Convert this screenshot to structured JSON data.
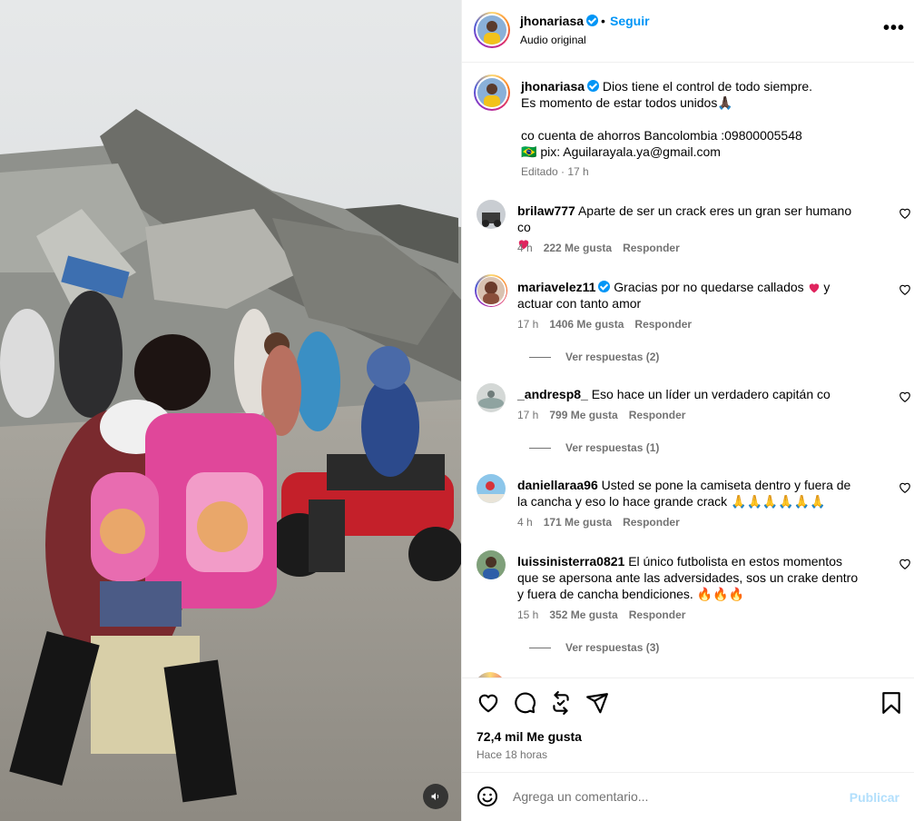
{
  "post": {
    "author": "jhonariasa",
    "follow_label": "Seguir",
    "separator": "•",
    "audio_label": "Audio original",
    "more_label": "•••",
    "caption_author": "jhonariasa",
    "caption_text": "Dios tiene el control de todo siempre.\nEs momento de estar todos unidos🙏🏿\n\nco cuenta de ahorros Bancolombia :09800005548\n🇧🇷 pix: Aguilarayala.ya@gmail.com",
    "caption_meta": "Editado · 17 h"
  },
  "comments": [
    {
      "user": "brilaw777",
      "verified": false,
      "text": "Aparte de ser un crack eres un gran ser humano co",
      "heart_emoji": true,
      "time": "4 h",
      "likes": "222 Me gusta",
      "reply_label": "Responder",
      "view_replies": ""
    },
    {
      "user": "mariavelez11",
      "verified": true,
      "text_before": "Gracias por no quedarse callados",
      "text_after": "y actuar con tanto amor",
      "time": "17 h",
      "likes": "1406 Me gusta",
      "reply_label": "Responder",
      "view_replies": "Ver respuestas (2)"
    },
    {
      "user": "_andresp8_",
      "verified": false,
      "text": "Eso hace un líder un verdadero capitán co",
      "time": "17 h",
      "likes": "799 Me gusta",
      "reply_label": "Responder",
      "view_replies": "Ver respuestas (1)"
    },
    {
      "user": "daniellaraa96",
      "verified": false,
      "text": "Usted se pone la camiseta dentro y fuera de la cancha y eso lo hace grande crack 🙏🙏🙏🙏🙏🙏",
      "time": "4 h",
      "likes": "171 Me gusta",
      "reply_label": "Responder",
      "view_replies": ""
    },
    {
      "user": "luissinisterra0821",
      "verified": false,
      "text": "El único futbolista en estos momentos que se apersona ante las adversidades, sos un crake dentro y fuera de cancha bendiciones. 🔥🔥🔥",
      "time": "15 h",
      "likes": "352 Me gusta",
      "reply_label": "Responder",
      "view_replies": "Ver respuestas (3)"
    }
  ],
  "stats": {
    "likes": "72,4 mil Me gusta",
    "time_ago": "Hace 18 horas"
  },
  "composer": {
    "placeholder": "Agrega un comentario...",
    "publish_label": "Publicar"
  },
  "icons": {
    "like": "heart-icon",
    "comment": "comment-icon",
    "repost": "repost-icon",
    "share": "send-icon",
    "save": "bookmark-icon",
    "sound": "speaker-icon",
    "emoji": "smiley-icon"
  },
  "colors": {
    "link_blue": "#0095f6",
    "secondary_text": "#737373",
    "publish_disabled": "#b2dffc",
    "heart_red": "#e0245e"
  }
}
